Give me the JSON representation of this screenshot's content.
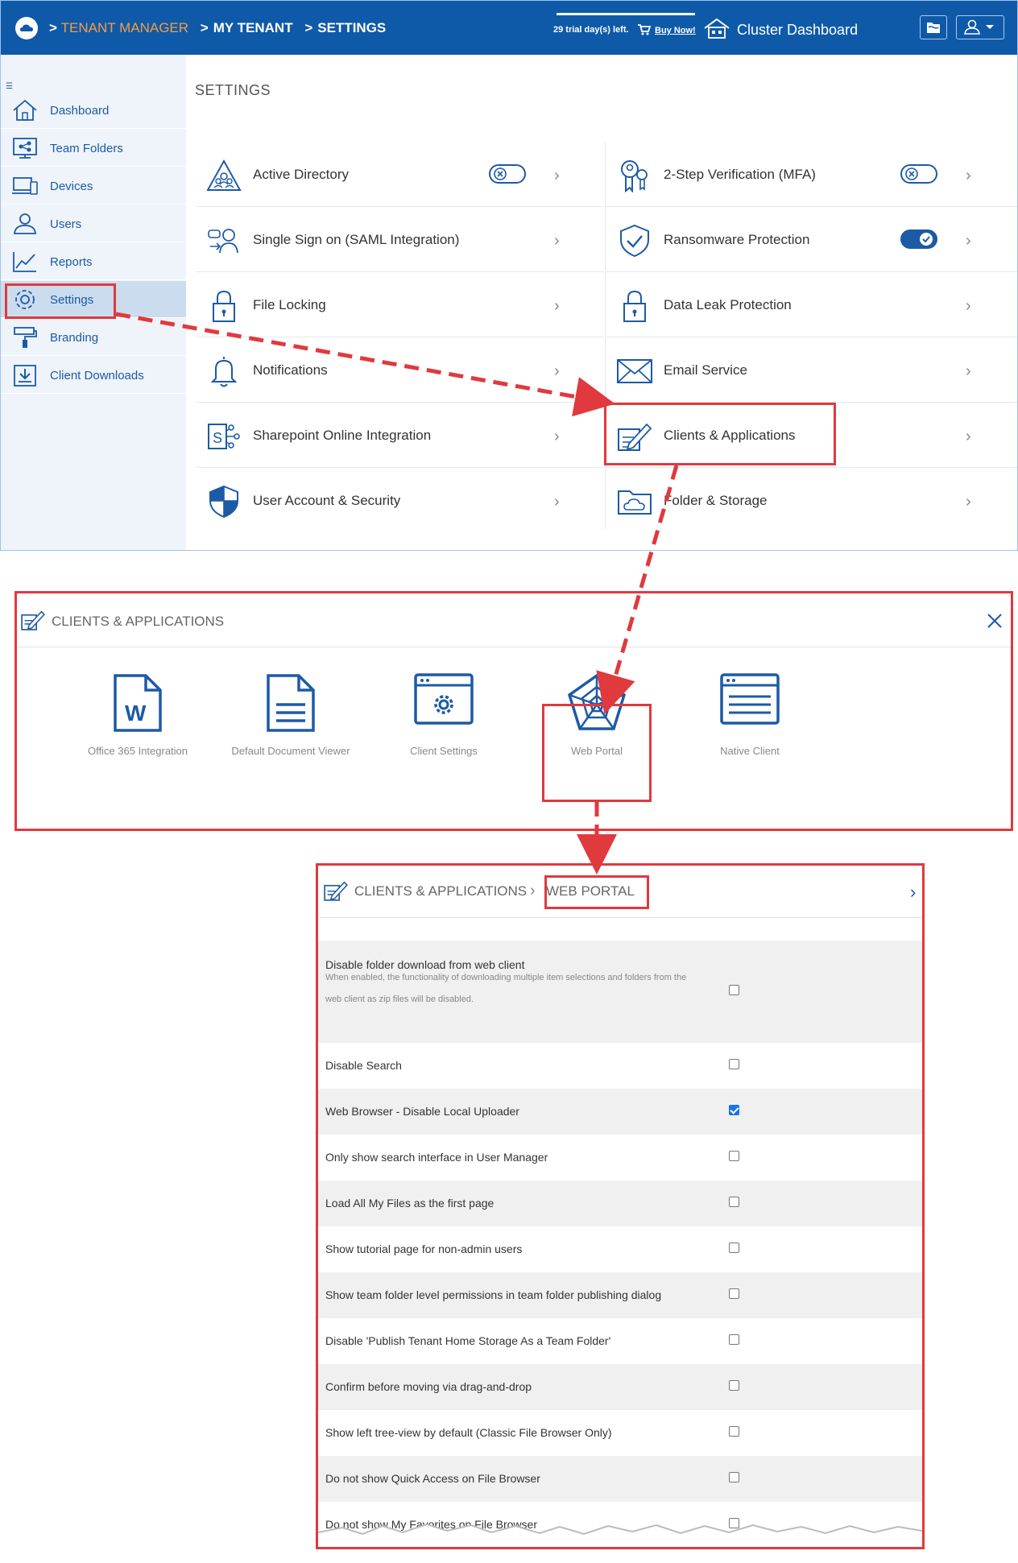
{
  "header": {
    "breadcrumb": [
      "TENANT MANAGER",
      "MY TENANT",
      "SETTINGS"
    ],
    "trial_text": "29 trial day(s) left.",
    "buy_now": "Buy Now!",
    "cluster_dashboard": "Cluster Dashboard"
  },
  "sidebar": {
    "items": [
      {
        "label": "Dashboard",
        "icon": "home-icon"
      },
      {
        "label": "Team Folders",
        "icon": "team-folders-icon"
      },
      {
        "label": "Devices",
        "icon": "devices-icon"
      },
      {
        "label": "Users",
        "icon": "users-icon"
      },
      {
        "label": "Reports",
        "icon": "reports-icon"
      },
      {
        "label": "Settings",
        "icon": "gear-icon",
        "active": true
      },
      {
        "label": "Branding",
        "icon": "paint-roller-icon"
      },
      {
        "label": "Client Downloads",
        "icon": "download-icon"
      }
    ]
  },
  "settings": {
    "title": "SETTINGS",
    "left": [
      {
        "label": "Active Directory",
        "toggle": "off"
      },
      {
        "label": "Single Sign on (SAML Integration)"
      },
      {
        "label": "File Locking"
      },
      {
        "label": "Notifications"
      },
      {
        "label": "Sharepoint Online Integration"
      },
      {
        "label": "User Account & Security"
      }
    ],
    "right": [
      {
        "label": "2-Step Verification (MFA)",
        "toggle": "off"
      },
      {
        "label": "Ransomware Protection",
        "toggle": "on"
      },
      {
        "label": "Data Leak Protection"
      },
      {
        "label": "Email Service"
      },
      {
        "label": "Clients & Applications"
      },
      {
        "label": "Folder & Storage"
      }
    ]
  },
  "clients_apps": {
    "title": "CLIENTS & APPLICATIONS",
    "tiles": [
      {
        "label": "Office 365 Integration",
        "icon": "word-document-icon"
      },
      {
        "label": "Default Document Viewer",
        "icon": "document-icon"
      },
      {
        "label": "Client Settings",
        "icon": "window-gear-icon"
      },
      {
        "label": "Web Portal",
        "icon": "web-icon"
      },
      {
        "label": "Native Client",
        "icon": "window-lines-icon"
      }
    ]
  },
  "web_portal": {
    "crumb_parent": "CLIENTS & APPLICATIONS",
    "crumb_current": "WEB PORTAL",
    "options": [
      {
        "label": "Disable folder download from web client",
        "desc": "When enabled, the functionality of downloading multiple item selections and folders from the web client as zip files will be disabled.",
        "checked": false
      },
      {
        "label": "Disable Search",
        "checked": false
      },
      {
        "label": "Web Browser - Disable Local Uploader",
        "checked": true
      },
      {
        "label": "Only show search interface in User Manager",
        "checked": false
      },
      {
        "label": "Load All My Files as the first page",
        "checked": false
      },
      {
        "label": "Show tutorial page for non-admin users",
        "checked": false
      },
      {
        "label": "Show team folder level permissions in team folder publishing dialog",
        "checked": false
      },
      {
        "label": "Disable 'Publish Tenant Home Storage As a Team Folder'",
        "checked": false
      },
      {
        "label": "Confirm before moving via drag-and-drop",
        "checked": false
      },
      {
        "label": "Show left tree-view by default (Classic File Browser Only)",
        "checked": false
      },
      {
        "label": "Do not show Quick Access on File Browser",
        "checked": false
      },
      {
        "label": "Do not show My Favorites on File Browser",
        "checked": false
      }
    ]
  },
  "colors": {
    "brand_blue": "#0f5aa8",
    "accent_orange": "#f39c4a",
    "highlight_red": "#e0393e",
    "icon_blue": "#1d5aa6"
  }
}
